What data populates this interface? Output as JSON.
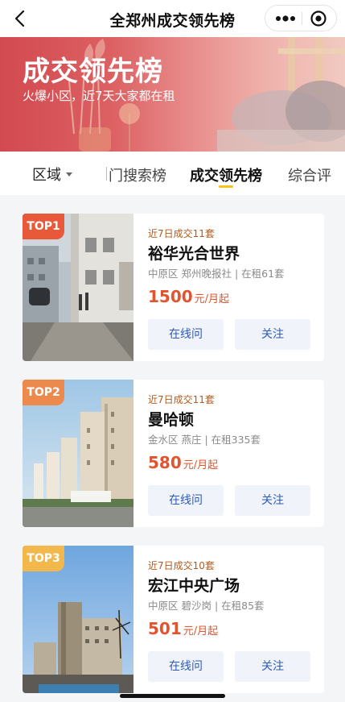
{
  "nav": {
    "title": "全郑州成交领先榜",
    "back_icon": "chevron-left-icon",
    "more_icon": "more-dots-icon",
    "close_icon": "target-close-icon"
  },
  "banner": {
    "title": "成交领先榜",
    "subtitle": "火爆小区，近7天大家都在租",
    "color_start": "#d24a4f",
    "color_end": "#f1c9c0"
  },
  "tabs": {
    "area_label": "区域",
    "items": [
      {
        "label": "热门搜索榜",
        "visible_text": "门搜索榜",
        "active": false
      },
      {
        "label": "成交领先榜",
        "active": true
      },
      {
        "label": "综合评",
        "visible_text": "综合评",
        "active": false
      }
    ],
    "indicator_color": "#f5c518"
  },
  "cards": [
    {
      "rank": "TOP1",
      "badge_color": "#e8593a",
      "deal_text": "近7日成交11套",
      "name": "裕华光合世界",
      "meta": "中原区 郑州晚报社 | 在租61套",
      "price": "1500",
      "price_unit": "元/月起",
      "consult_label": "在线问",
      "follow_label": "关注"
    },
    {
      "rank": "TOP2",
      "badge_color": "#ec8a4e",
      "deal_text": "近7日成交11套",
      "name": "曼哈顿",
      "meta": "金水区 燕庄 | 在租335套",
      "price": "580",
      "price_unit": "元/月起",
      "consult_label": "在线问",
      "follow_label": "关注"
    },
    {
      "rank": "TOP3",
      "badge_color": "#f2b84b",
      "deal_text": "近7日成交10套",
      "name": "宏江中央广场",
      "meta": "中原区 碧沙岗 | 在租85套",
      "price": "501",
      "price_unit": "元/月起",
      "consult_label": "在线问",
      "follow_label": "关注"
    }
  ],
  "colors": {
    "accent_price": "#e2542e",
    "deal_text": "#b25a1e",
    "button_text": "#2d5bb8"
  }
}
